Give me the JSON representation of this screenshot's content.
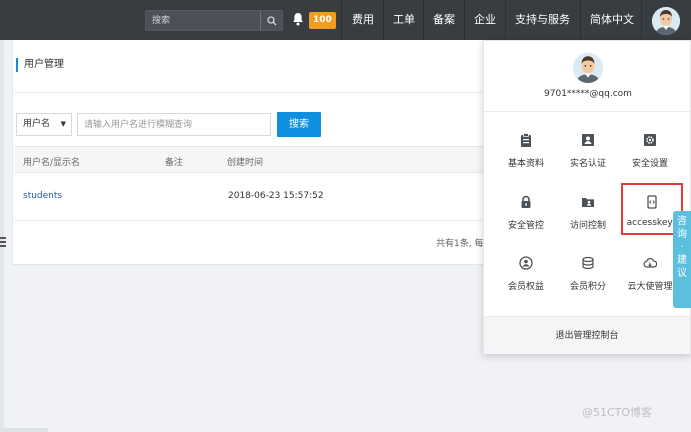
{
  "topbar": {
    "search_placeholder": "搜索",
    "notification_count": "100",
    "nav": [
      "费用",
      "工单",
      "备案",
      "企业",
      "支持与服务",
      "简体中文"
    ]
  },
  "page": {
    "title": "用户管理",
    "filter_select": "用户名",
    "search_placeholder": "请输入用户名进行模糊查询",
    "search_button": "搜索",
    "columns": [
      "用户名/显示名",
      "备注",
      "创建时间"
    ],
    "rows": [
      {
        "username": "students",
        "note": "",
        "created": "2018-06-23 15:57:52"
      }
    ],
    "pager_text": "共有1条, 每"
  },
  "dropdown": {
    "email": "9701*****@qq.com",
    "items": [
      {
        "label": "基本资料",
        "icon": "clipboard-icon"
      },
      {
        "label": "实名认证",
        "icon": "id-card-icon"
      },
      {
        "label": "安全设置",
        "icon": "gear-icon"
      },
      {
        "label": "安全管控",
        "icon": "lock-icon"
      },
      {
        "label": "访问控制",
        "icon": "folder-user-icon"
      },
      {
        "label": "accesskeys",
        "icon": "code-brackets-icon"
      },
      {
        "label": "会员权益",
        "icon": "user-circle-icon"
      },
      {
        "label": "会员积分",
        "icon": "database-icon"
      },
      {
        "label": "云大使管理",
        "icon": "cloud-icon"
      }
    ],
    "logout": "退出管理控制台"
  },
  "feedback_tab": "咨询·建议",
  "watermark": "@51CTO博客",
  "colors": {
    "topbar": "#373d41",
    "badge": "#f19d22",
    "primary": "#0f8fdd",
    "link": "#1b5aa8",
    "highlight": "#e43b3b",
    "feedback": "#5bc0de"
  }
}
